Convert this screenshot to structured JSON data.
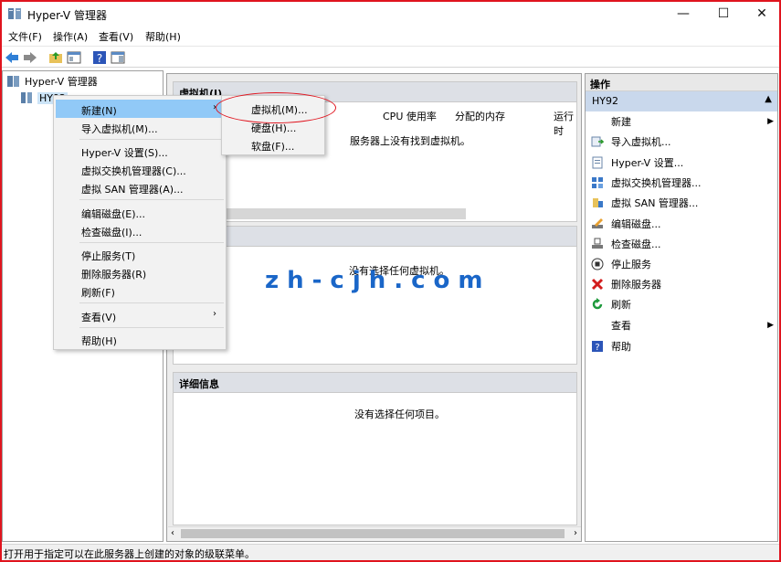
{
  "window": {
    "title": "Hyper-V 管理器",
    "minimize": "—",
    "maximize": "☐",
    "close": "✕"
  },
  "menu": [
    "文件(F)",
    "操作(A)",
    "查看(V)",
    "帮助(H)"
  ],
  "tree": {
    "root": "Hyper-V 管理器",
    "server": "HY92"
  },
  "vm_panel": {
    "title": "虚拟机(I)",
    "columns": [
      "CPU 使用率",
      "分配的内存",
      "运行时"
    ],
    "empty_message": "服务器上没有找到虚拟机。"
  },
  "checkpoint_panel": {
    "empty_message": "没有选择任何虚拟机。"
  },
  "details_panel": {
    "title": "详细信息",
    "empty_message": "没有选择任何项目。"
  },
  "actions": {
    "title": "操作",
    "section": "HY92",
    "items": [
      "新建",
      "导入虚拟机...",
      "Hyper-V 设置...",
      "虚拟交换机管理器...",
      "虚拟 SAN 管理器...",
      "编辑磁盘...",
      "检查磁盘...",
      "停止服务",
      "删除服务器",
      "刷新",
      "查看",
      "帮助"
    ]
  },
  "context_menu": {
    "items": [
      "新建(N)",
      "导入虚拟机(M)...",
      "Hyper-V 设置(S)...",
      "虚拟交换机管理器(C)...",
      "虚拟 SAN 管理器(A)...",
      "编辑磁盘(E)...",
      "检查磁盘(I)...",
      "停止服务(T)",
      "删除服务器(R)",
      "刷新(F)",
      "查看(V)",
      "帮助(H)"
    ]
  },
  "submenu": {
    "items": [
      "虚拟机(M)...",
      "硬盘(H)...",
      "软盘(F)..."
    ]
  },
  "watermark": "zh-cjh.com",
  "status": "打开用于指定可以在此服务器上创建的对象的级联菜单。",
  "colors": {
    "highlight": "#91c9f7",
    "annotation": "#e0141e",
    "watermark": "#1a66c8",
    "action_section": "#c9d8ec"
  }
}
